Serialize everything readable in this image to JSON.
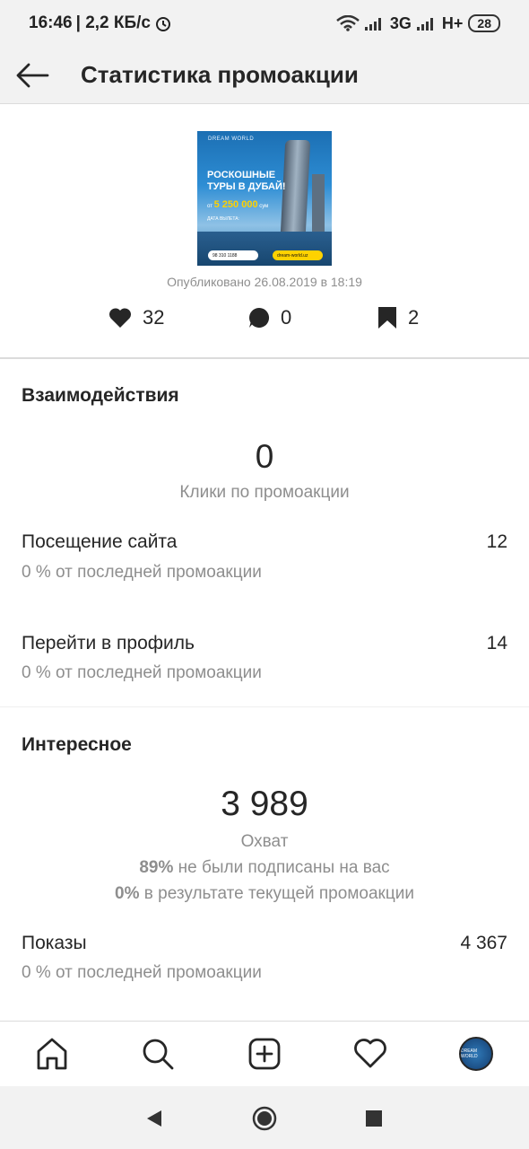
{
  "status_bar": {
    "time": "16:46",
    "speed": "| 2,2 КБ/с",
    "net1": "3G",
    "net2": "H+",
    "battery": "28"
  },
  "header": {
    "title": "Статистика промоакции"
  },
  "post": {
    "image": {
      "brand": "DREAM WORLD",
      "headline": "РОСКОШНЫЕ ТУРЫ В ДУБАЙ!",
      "price_prefix": "от",
      "price": "5 250 000",
      "price_suffix": "сум",
      "date_text": "ДАТА ВЫЛЕТА:",
      "phone": "98 310 1188",
      "site": "dream-world.uz"
    },
    "published": "Опубликовано 26.08.2019 в 18:19",
    "likes": "32",
    "comments": "0",
    "saves": "2"
  },
  "interactions": {
    "title": "Взаимодействия",
    "clicks_value": "0",
    "clicks_label": "Клики по промоакции",
    "rows": [
      {
        "label": "Посещение сайта",
        "value": "12",
        "sub": "0 % от последней промоакции"
      },
      {
        "label": "Перейти в профиль",
        "value": "14",
        "sub": "0 % от последней промоакции"
      }
    ]
  },
  "discovery": {
    "title": "Интересное",
    "reach_value": "3 989",
    "reach_label": "Охват",
    "not_following_pct": "89%",
    "not_following_text": " не были подписаны на вас",
    "from_promo_pct": "0%",
    "from_promo_text": " в результате текущей промоакции",
    "rows": [
      {
        "label": "Показы",
        "value": "4 367",
        "sub": "0 % от последней промоакции"
      }
    ]
  },
  "avatar_text": "DREAM WORLD"
}
